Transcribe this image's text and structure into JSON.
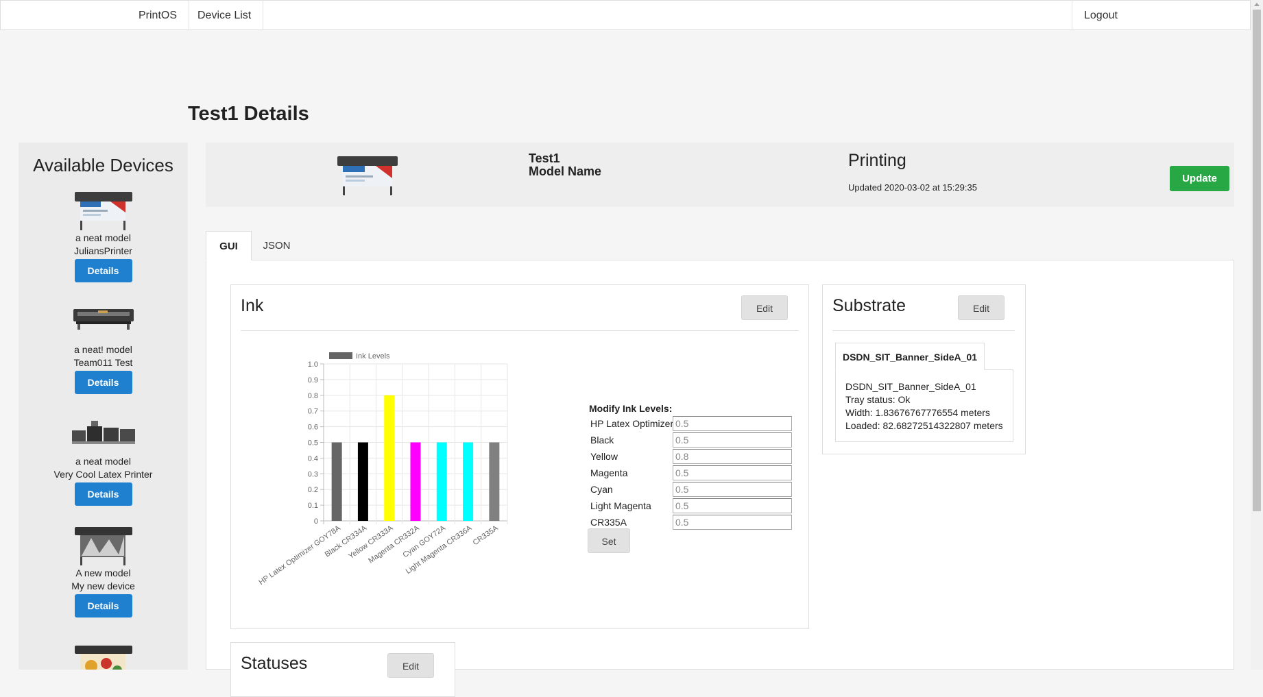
{
  "nav": {
    "brand": "PrintOS",
    "device_list": "Device List",
    "logout": "Logout"
  },
  "page": {
    "title": "Test1 Details"
  },
  "sidebar": {
    "title": "Available Devices",
    "details_label": "Details",
    "devices": [
      {
        "model": "a neat model",
        "name": "JuliansPrinter"
      },
      {
        "model": "a neat! model",
        "name": "Team011 Test"
      },
      {
        "model": "a neat model",
        "name": "Very Cool Latex Printer"
      },
      {
        "model": "A new model",
        "name": "My new device"
      }
    ]
  },
  "device": {
    "name": "Test1",
    "model": "Model Name",
    "status": "Printing",
    "updated": "Updated 2020-03-02 at 15:29:35",
    "update_label": "Update"
  },
  "tabs": {
    "gui": "GUI",
    "json": "JSON"
  },
  "ink": {
    "title": "Ink",
    "edit_label": "Edit",
    "modify_title": "Modify Ink Levels:",
    "set_label": "Set",
    "rows": [
      {
        "label": "HP Latex Optimizer",
        "value": "0.5"
      },
      {
        "label": "Black",
        "value": "0.5"
      },
      {
        "label": "Yellow",
        "value": "0.8"
      },
      {
        "label": "Magenta",
        "value": "0.5"
      },
      {
        "label": "Cyan",
        "value": "0.5"
      },
      {
        "label": "Light Magenta",
        "value": "0.5"
      },
      {
        "label": "CR335A",
        "value": "0.5"
      }
    ]
  },
  "chart_data": {
    "type": "bar",
    "legend": "Ink Levels",
    "legend_position": "top",
    "grid": true,
    "categories": [
      "HP Latex Optimizer GOY78A",
      "Black CR334A",
      "Yellow CR333A",
      "Magenta CR332A",
      "Cyan GOY72A",
      "Light Magenta CR336A",
      "CR335A"
    ],
    "values": [
      0.5,
      0.5,
      0.8,
      0.5,
      0.5,
      0.5,
      0.5
    ],
    "colors": [
      "#666666",
      "#000000",
      "#ffff00",
      "#ff00ff",
      "#00ffff",
      "#00ffff",
      "#808080"
    ],
    "ylim": [
      0,
      1
    ],
    "yticks": [
      "0",
      "0.1",
      "0.2",
      "0.3",
      "0.4",
      "0.5",
      "0.6",
      "0.7",
      "0.8",
      "0.9",
      "1.0"
    ]
  },
  "substrate": {
    "title": "Substrate",
    "edit_label": "Edit",
    "tab": "DSDN_SIT_Banner_SideA_01",
    "name": "DSDN_SIT_Banner_SideA_01",
    "tray": "Tray status: Ok",
    "width": "Width: 1.83676767776554 meters",
    "loaded": "Loaded: 82.68272514322807 meters"
  },
  "statuses": {
    "title": "Statuses",
    "edit_label": "Edit"
  }
}
